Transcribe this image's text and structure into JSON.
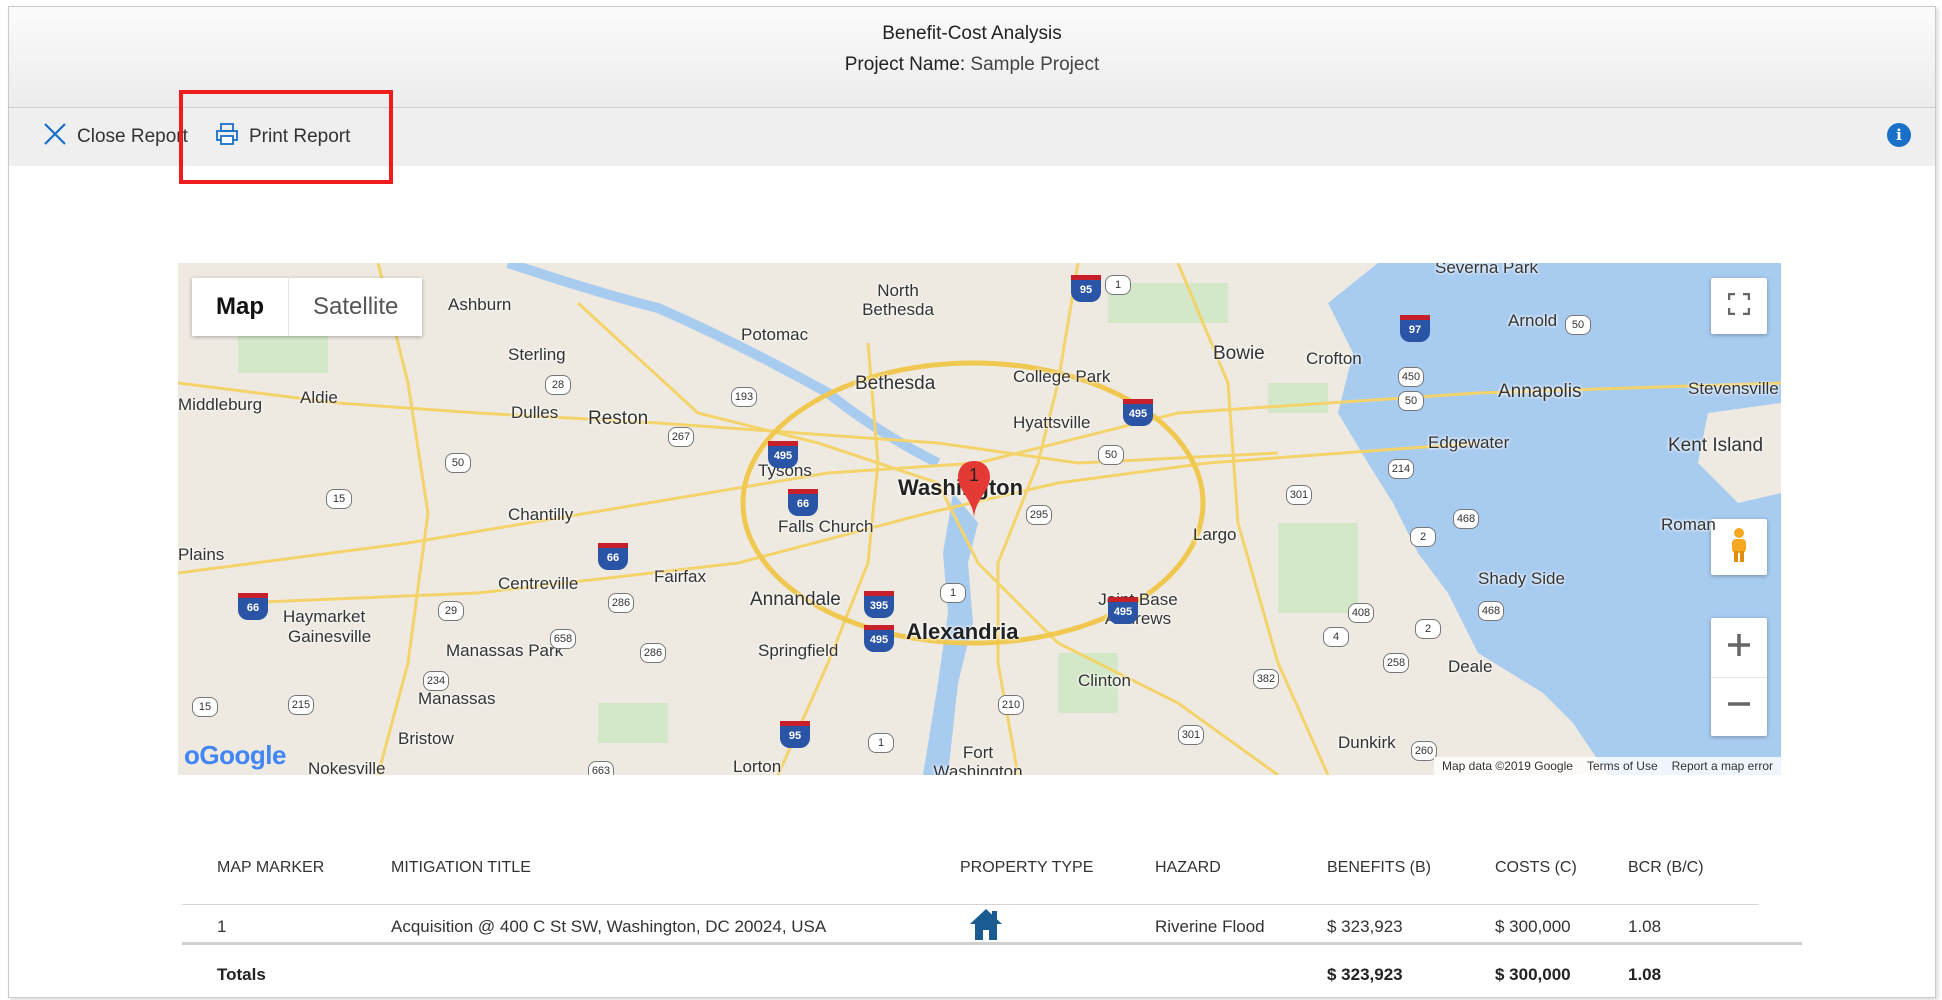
{
  "header": {
    "title": "Benefit-Cost Analysis",
    "project_label": "Project Name:",
    "project_name": "Sample Project"
  },
  "toolbar": {
    "close_label": "Close Report",
    "print_label": "Print Report",
    "info_icon": "i"
  },
  "map": {
    "toggle_map": "Map",
    "toggle_satellite": "Satellite",
    "marker_label": "1",
    "google_logo": "Google",
    "attribution": {
      "data": "Map data ©2019 Google",
      "terms": "Terms of Use",
      "report": "Report a map error"
    },
    "places": [
      "Ashburn",
      "North Bethesda",
      "Potomac",
      "Sterling",
      "Bethesda",
      "College Park",
      "Bowie",
      "Crofton",
      "Arnold",
      "Severna Park",
      "Middleburg",
      "Aldie",
      "Dulles",
      "Reston",
      "Hyattsville",
      "Annapolis",
      "Stevensville",
      "Edgewater",
      "Kent Island",
      "Tysons",
      "Washington",
      "Chantilly",
      "Falls Church",
      "Largo",
      "Roman",
      "Plains",
      "Centreville",
      "Fairfax",
      "Annandale",
      "Shady Side",
      "Haymarket",
      "Gainesville",
      "Alexandria",
      "Joint Base Andrews",
      "Manassas Park",
      "Springfield",
      "Clinton",
      "Deale",
      "Manassas",
      "Bristow",
      "Fort Washington",
      "Dunkirk",
      "Lorton",
      "Nokesville"
    ]
  },
  "table": {
    "columns": [
      "MAP MARKER",
      "MITIGATION TITLE",
      "PROPERTY TYPE",
      "HAZARD",
      "BENEFITS (B)",
      "COSTS (C)",
      "BCR (B/C)"
    ],
    "rows": [
      {
        "marker": "1",
        "title": "Acquisition @ 400 C St SW, Washington, DC 20024, USA",
        "property_icon": "house-icon",
        "hazard": "Riverine Flood",
        "benefits": "$ 323,923",
        "costs": "$ 300,000",
        "bcr": "1.08"
      }
    ],
    "totals": {
      "label": "Totals",
      "benefits": "$ 323,923",
      "costs": "$ 300,000",
      "bcr": "1.08"
    }
  },
  "colors": {
    "highlight": "#ee1c1c",
    "info": "#1a6fc9",
    "marker": "#e53935",
    "house": "#1a5b92",
    "water": "#a8cbf0"
  }
}
